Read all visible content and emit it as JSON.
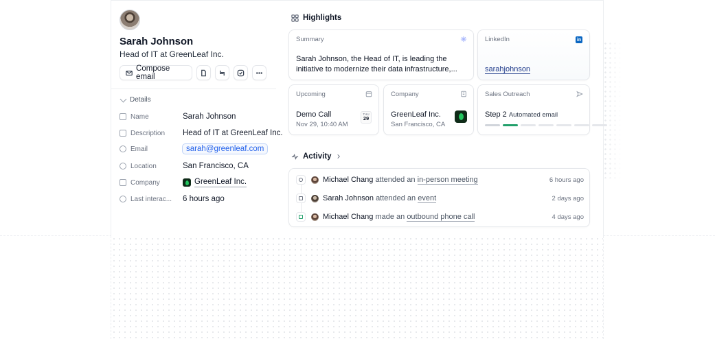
{
  "profile": {
    "name": "Sarah Johnson",
    "role": "Head of IT at GreenLeaf Inc.",
    "compose_label": "Compose email"
  },
  "details": {
    "header": "Details",
    "fields": {
      "name_label": "Name",
      "name_value": "Sarah Johnson",
      "description_label": "Description",
      "description_value": "Head of IT at GreenLeaf Inc.",
      "email_label": "Email",
      "email_value": "sarah@greenleaf.com",
      "location_label": "Location",
      "location_value": "San Francisco, CA",
      "company_label": "Company",
      "company_value": "GreenLeaf Inc.",
      "last_interaction_label": "Last interac...",
      "last_interaction_value": "6 hours ago"
    }
  },
  "highlights": {
    "title": "Highlights",
    "summary": {
      "title": "Summary",
      "text": "Sarah Johnson, the Head of IT, is leading the initiative to modernize their data infrastructure,..."
    },
    "linkedin": {
      "title": "LinkedIn",
      "handle": "sarahjohnson",
      "badge": "in"
    },
    "upcoming": {
      "title": "Upcoming",
      "event": "Demo Call",
      "when": "Nov 29, 10:40 AM",
      "cal_month": "THU",
      "cal_day": "29"
    },
    "company": {
      "title": "Company",
      "name": "GreenLeaf Inc.",
      "location": "San Francisco, CA"
    },
    "outreach": {
      "title": "Sales Outreach",
      "step": "Step 2",
      "step_desc": "Automated email",
      "progress_segments": 7,
      "active_segment": 2
    }
  },
  "activity": {
    "title": "Activity",
    "items": [
      {
        "actor": "Michael Chang",
        "verb": "attended an",
        "object": "in-person meeting",
        "time": "6 hours ago"
      },
      {
        "actor": "Sarah Johnson",
        "verb": "attended an",
        "object": "event",
        "time": "2 days ago"
      },
      {
        "actor": "Michael Chang",
        "verb": "made an",
        "object": "outbound phone call",
        "time": "4 days ago"
      }
    ]
  },
  "colors": {
    "link": "#2563eb",
    "progress_active": "#22a06b",
    "linkedin": "#0a66c2",
    "brand_dark": "#0f2b18"
  }
}
